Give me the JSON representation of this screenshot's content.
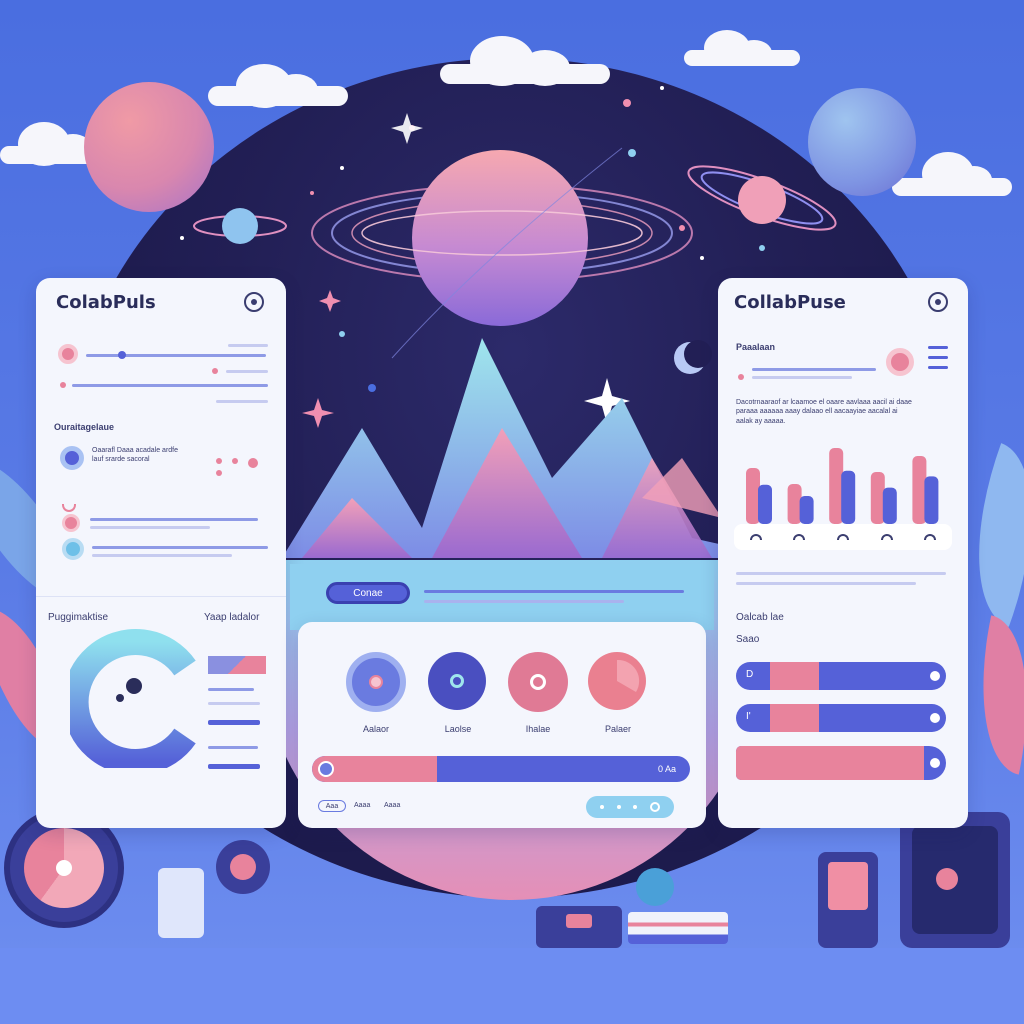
{
  "left_panel": {
    "title": "ColabPuls",
    "section_label": "Ouraitagelaue",
    "item_text": "Oaarafl Daaa acadale ardfe\nlauf srarde sacoral",
    "bottom_left_label": "Puggimaktise",
    "bottom_right_label": "Yaap ladalor"
  },
  "center_panel": {
    "button_label": "Conae",
    "actions": [
      {
        "label": "Aalaor",
        "color": "#6a7be0"
      },
      {
        "label": "Laolse",
        "color": "#4a4fc0"
      },
      {
        "label": "Ihalae",
        "color": "#e07a95"
      },
      {
        "label": "Palaer",
        "color": "#ea8090"
      }
    ],
    "progress_label": "0 Aa",
    "progress_value": 0.33,
    "tab_labels": [
      "Aaa",
      "Aaaa",
      "Aaaa"
    ]
  },
  "right_panel": {
    "title": "CollabPuse",
    "section_label": "Paaalaan",
    "paragraph": "Dacotrnaaraof ar lcaamoe el oaare aavlaaa aacil ai daae\nparaaa aaaaaa aaay dalaao ell aacaayiae aacalal ai\naalak ay aaaaa.",
    "chart_values": [
      0.7,
      0.5,
      0.95,
      0.65,
      0.85
    ],
    "sub_title": "Oalcab lae",
    "sub_label": "Saao",
    "slider_values": [
      {
        "label": "D",
        "value": 0.18
      },
      {
        "label": "I'",
        "value": 0.18
      },
      {
        "label": "",
        "value": 1.0
      }
    ]
  },
  "colors": {
    "accent": "#5561d8",
    "pink": "#e8839c",
    "panel": "#f4f6fd"
  }
}
